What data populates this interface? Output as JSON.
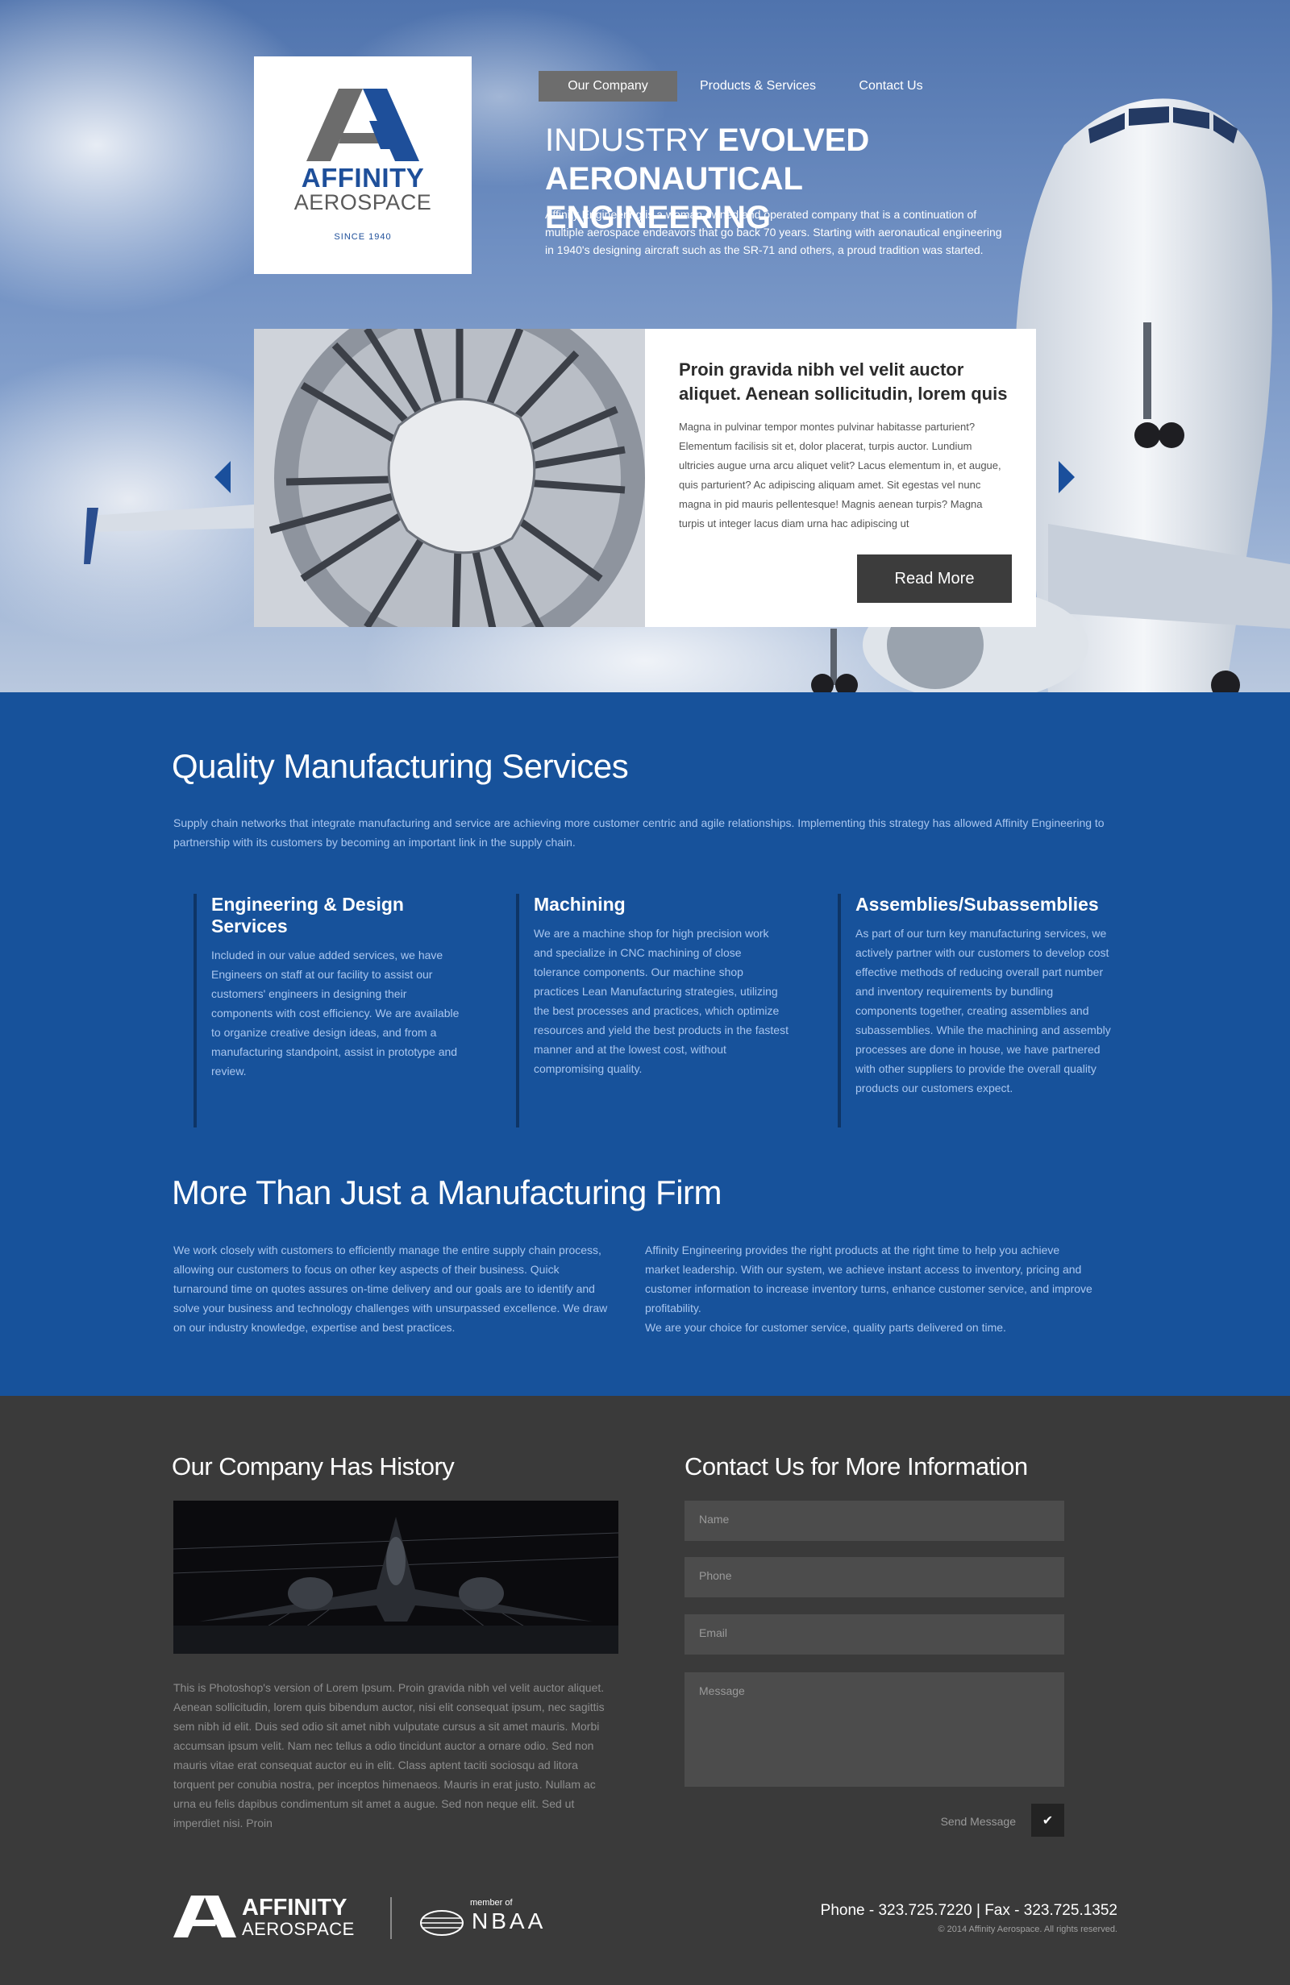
{
  "brand": {
    "name": "AFFINITY",
    "sub": "AEROSPACE",
    "since": "SINCE 1940",
    "colors": {
      "primary": "#17529b",
      "dark": "#3a3a3a",
      "accent": "#1e4f9a"
    }
  },
  "nav": {
    "items": [
      {
        "label": "Our Company",
        "active": true
      },
      {
        "label": "Products & Services",
        "active": false
      },
      {
        "label": "Contact Us",
        "active": false
      }
    ]
  },
  "hero": {
    "title_thin": "INDUSTRY ",
    "title_bold1": "EVOLVED",
    "title_bold2": "AERONAUTICAL ENGINEERING",
    "text": "Affinity Engineering is a woman owned and operated company that is a continuation of multiple aerospace endeavors that go back 70 years.  Starting with aeronautical engineering in 1940's designing aircraft such as the SR-71 and others, a proud tradition was started."
  },
  "slider": {
    "title": "Proin gravida nibh vel velit auctor aliquet. Aenean sollicitudin, lorem quis",
    "body": "Magna in pulvinar tempor montes pulvinar habitasse parturient? Elementum facilisis sit et, dolor placerat, turpis auctor. Lundium ultricies augue urna arcu aliquet velit?  Lacus elementum in, et augue, quis parturient? Ac adipiscing aliquam amet. Sit egestas vel nunc magna in pid mauris pellentesque! Magnis aenean turpis? Magna turpis ut integer lacus diam urna hac adipiscing ut",
    "button": "Read More",
    "prev_icon": "arrow-left-icon",
    "next_icon": "arrow-right-icon"
  },
  "quality": {
    "title": "Quality Manufacturing Services",
    "intro": "Supply chain networks that integrate manufacturing and service are achieving more customer centric and agile relationships. Implementing this strategy has allowed Affinity Engineering to partnership with its customers by becoming an important link in the supply chain.",
    "columns": [
      {
        "title": "Engineering & Design Services",
        "text": "Included in our value added services, we have Engineers on staff at our facility to assist our customers' engineers in designing their components with cost efficiency. We are available to organize creative design ideas, and from a manufacturing standpoint, assist in prototype and review."
      },
      {
        "title": "Machining",
        "text": "We are a machine shop for high precision work and specialize in CNC machining of close tolerance components. Our machine shop practices Lean Manufacturing strategies, utilizing the best processes and practices, which optimize resources and yield the best products in the fastest manner and at the lowest cost, without compromising quality."
      },
      {
        "title": "Assemblies/Subassemblies",
        "text": "As part of our turn key manufacturing services, we actively partner with our customers to develop cost effective methods of reducing overall part number and inventory requirements by bundling components together, creating assemblies and subassemblies. While the machining and assembly processes are done in house, we have partnered with other suppliers to provide the overall quality products our customers expect."
      }
    ]
  },
  "more": {
    "title": "More Than Just a Manufacturing Firm",
    "left": "We work closely with customers to efficiently manage the entire supply chain process, allowing our customers to focus on other key aspects of their business. Quick turnaround time on quotes assures on-time delivery and our goals are to identify and solve your business and technology challenges with unsurpassed excellence. We draw on our industry knowledge, expertise and best practices.",
    "right_1": "Affinity Engineering provides the right products at the right time to help you achieve market leadership. With our system, we achieve instant access to inventory, pricing and customer information to increase inventory turns, enhance customer service, and improve profitability.",
    "right_2": "We are your choice for customer service, quality parts delivered on time."
  },
  "history": {
    "title": "Our Company Has History",
    "text": "This is Photoshop's version  of Lorem Ipsum. Proin gravida nibh vel velit auctor aliquet. Aenean sollicitudin, lorem quis bibendum auctor, nisi elit consequat ipsum, nec sagittis sem nibh id elit. Duis sed odio sit amet nibh vulputate cursus a sit amet mauris. Morbi accumsan ipsum velit. Nam nec tellus a odio tincidunt auctor a ornare odio. Sed non  mauris vitae erat consequat auctor eu in elit. Class aptent taciti sociosqu ad litora torquent per conubia nostra, per inceptos himenaeos. Mauris in erat justo. Nullam ac urna eu felis dapibus condimentum sit amet a augue. Sed non neque elit. Sed ut imperdiet nisi. Proin"
  },
  "contact": {
    "title": "Contact Us for More Information",
    "name_placeholder": "Name",
    "phone_placeholder": "Phone",
    "email_placeholder": "Email",
    "message_placeholder": "Message",
    "send_label": "Send Message",
    "send_icon": "checkmark-icon"
  },
  "footer": {
    "brand_name": "AFFINITY",
    "brand_sub": "AEROSPACE",
    "member_of": "member of",
    "nbaa": "NBAA",
    "phone_fax": "Phone - 323.725.7220  |  Fax - 323.725.1352",
    "copyright": "© 2014 Affinity Aerospace. All rights reserved."
  }
}
